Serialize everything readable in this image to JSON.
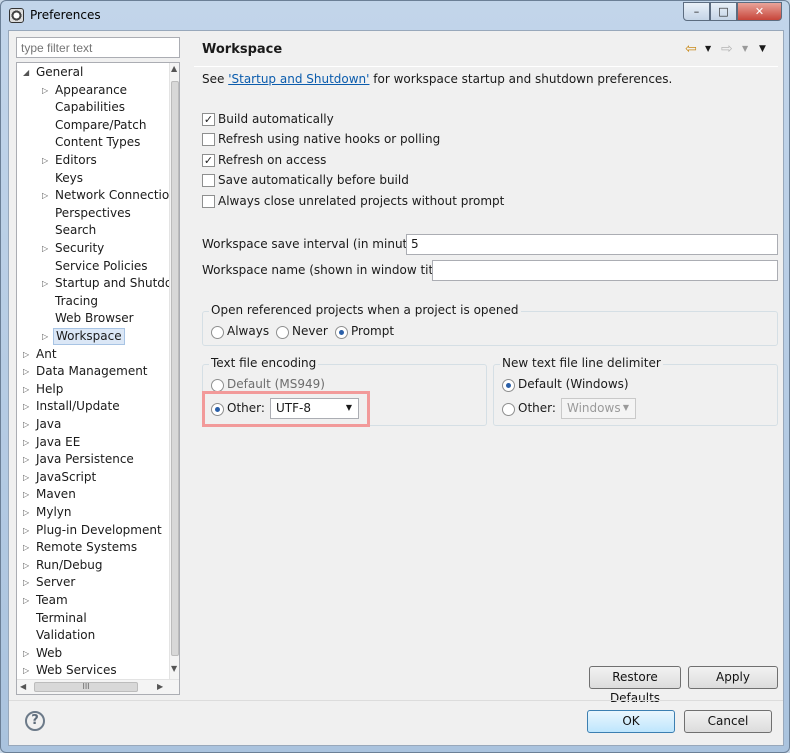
{
  "window": {
    "title": "Preferences",
    "minimize": "–",
    "maximize": "□",
    "close": "✕"
  },
  "filter": {
    "placeholder": "type filter text"
  },
  "tree": [
    {
      "label": "General",
      "level": 0,
      "twisty": "expanded"
    },
    {
      "label": "Appearance",
      "level": 1,
      "twisty": "collapsed"
    },
    {
      "label": "Capabilities",
      "level": 1,
      "twisty": "none"
    },
    {
      "label": "Compare/Patch",
      "level": 1,
      "twisty": "none"
    },
    {
      "label": "Content Types",
      "level": 1,
      "twisty": "none"
    },
    {
      "label": "Editors",
      "level": 1,
      "twisty": "collapsed"
    },
    {
      "label": "Keys",
      "level": 1,
      "twisty": "none"
    },
    {
      "label": "Network Connectio",
      "level": 1,
      "twisty": "collapsed"
    },
    {
      "label": "Perspectives",
      "level": 1,
      "twisty": "none"
    },
    {
      "label": "Search",
      "level": 1,
      "twisty": "none"
    },
    {
      "label": "Security",
      "level": 1,
      "twisty": "collapsed"
    },
    {
      "label": "Service Policies",
      "level": 1,
      "twisty": "none"
    },
    {
      "label": "Startup and Shutdo",
      "level": 1,
      "twisty": "collapsed"
    },
    {
      "label": "Tracing",
      "level": 1,
      "twisty": "none"
    },
    {
      "label": "Web Browser",
      "level": 1,
      "twisty": "none"
    },
    {
      "label": "Workspace",
      "level": 1,
      "twisty": "collapsed",
      "selected": true
    },
    {
      "label": "Ant",
      "level": 0,
      "twisty": "collapsed"
    },
    {
      "label": "Data Management",
      "level": 0,
      "twisty": "collapsed"
    },
    {
      "label": "Help",
      "level": 0,
      "twisty": "collapsed"
    },
    {
      "label": "Install/Update",
      "level": 0,
      "twisty": "collapsed"
    },
    {
      "label": "Java",
      "level": 0,
      "twisty": "collapsed"
    },
    {
      "label": "Java EE",
      "level": 0,
      "twisty": "collapsed"
    },
    {
      "label": "Java Persistence",
      "level": 0,
      "twisty": "collapsed"
    },
    {
      "label": "JavaScript",
      "level": 0,
      "twisty": "collapsed"
    },
    {
      "label": "Maven",
      "level": 0,
      "twisty": "collapsed"
    },
    {
      "label": "Mylyn",
      "level": 0,
      "twisty": "collapsed"
    },
    {
      "label": "Plug-in Development",
      "level": 0,
      "twisty": "collapsed"
    },
    {
      "label": "Remote Systems",
      "level": 0,
      "twisty": "collapsed"
    },
    {
      "label": "Run/Debug",
      "level": 0,
      "twisty": "collapsed"
    },
    {
      "label": "Server",
      "level": 0,
      "twisty": "collapsed"
    },
    {
      "label": "Team",
      "level": 0,
      "twisty": "collapsed"
    },
    {
      "label": "Terminal",
      "level": 0,
      "twisty": "none"
    },
    {
      "label": "Validation",
      "level": 0,
      "twisty": "none"
    },
    {
      "label": "Web",
      "level": 0,
      "twisty": "collapsed"
    },
    {
      "label": "Web Services",
      "level": 0,
      "twisty": "collapsed"
    }
  ],
  "scrollbars": {
    "up": "▲",
    "down": "▼",
    "left": "◀",
    "right": "▶",
    "hgrip": "III"
  },
  "page": {
    "title": "Workspace",
    "nav": {
      "back": "⇦",
      "forward": "⇨",
      "dropdown": "▼",
      "menu": "▼"
    },
    "intro_prefix": "See ",
    "intro_link": "'Startup and Shutdown'",
    "intro_suffix": " for workspace startup and shutdown preferences.",
    "checkboxes": [
      {
        "label": "Build automatically",
        "checked": true
      },
      {
        "label": "Refresh using native hooks or polling",
        "checked": false
      },
      {
        "label": "Refresh on access",
        "checked": true
      },
      {
        "label": "Save automatically before build",
        "checked": false
      },
      {
        "label": "Always close unrelated projects without prompt",
        "checked": false
      }
    ],
    "check_mark": "✓",
    "save_interval": {
      "label": "Workspace save interval (in minutes):",
      "value": "5"
    },
    "workspace_name": {
      "label": "Workspace name (shown in window title):",
      "value": ""
    },
    "open_referenced": {
      "title": "Open referenced projects when a project is opened",
      "options": [
        "Always",
        "Never",
        "Prompt"
      ],
      "selected": "Prompt"
    },
    "encoding": {
      "title": "Text file encoding",
      "default_label": "Default (MS949)",
      "other_label": "Other:",
      "selected": "Other",
      "value": "UTF-8"
    },
    "line_delimiter": {
      "title": "New text file line delimiter",
      "default_label": "Default (Windows)",
      "other_label": "Other:",
      "selected": "Default",
      "value": "Windows"
    },
    "restore_defaults": "Restore Defaults",
    "apply": "Apply"
  },
  "footer": {
    "help": "?",
    "ok": "OK",
    "cancel": "Cancel"
  },
  "colors": {
    "highlight": "#f29a9a",
    "link": "#0b5cad",
    "selection": "#dbe7f6"
  }
}
